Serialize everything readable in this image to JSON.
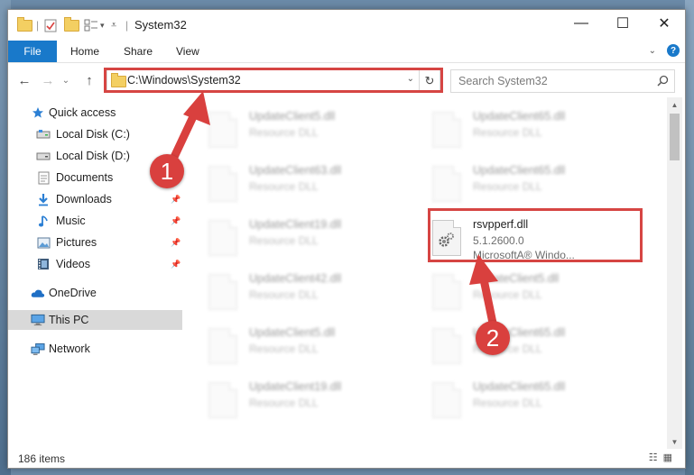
{
  "window": {
    "title": "System32",
    "controls": {
      "minimize": "—",
      "maximize": "☐",
      "close": "✕"
    }
  },
  "ribbon": {
    "tabs": [
      "File",
      "Home",
      "Share",
      "View"
    ],
    "help": "?"
  },
  "nav": {
    "back": "←",
    "forward": "→",
    "recent": "⌄",
    "up": "↑",
    "address": "C:\\Windows\\System32",
    "search_placeholder": "Search System32"
  },
  "sidebar": {
    "items": [
      {
        "label": "Quick access",
        "icon": "star-icon",
        "pinned": false
      },
      {
        "label": "Local Disk (C:)",
        "icon": "drive-icon",
        "pinned": false
      },
      {
        "label": "Local Disk (D:)",
        "icon": "drive-icon",
        "pinned": false
      },
      {
        "label": "Documents",
        "icon": "documents-icon",
        "pinned": true
      },
      {
        "label": "Downloads",
        "icon": "download-icon",
        "pinned": true
      },
      {
        "label": "Music",
        "icon": "music-icon",
        "pinned": true
      },
      {
        "label": "Pictures",
        "icon": "pictures-icon",
        "pinned": true
      },
      {
        "label": "Videos",
        "icon": "videos-icon",
        "pinned": true
      },
      {
        "label": "OneDrive",
        "icon": "cloud-icon",
        "pinned": false
      },
      {
        "label": "This PC",
        "icon": "computer-icon",
        "pinned": false,
        "selected": true
      },
      {
        "label": "Network",
        "icon": "network-icon",
        "pinned": false
      }
    ]
  },
  "files": {
    "left": [
      {
        "name": "UpdateClient5.dll",
        "type": "Resource DLL"
      },
      {
        "name": "UpdateClient63.dll",
        "type": "Resource DLL"
      },
      {
        "name": "UpdateClient19.dll",
        "type": "Resource DLL"
      },
      {
        "name": "UpdateClient42.dll",
        "type": "Resource DLL"
      },
      {
        "name": "UpdateClient5.dll",
        "type": "Resource DLL"
      },
      {
        "name": "UpdateClient19.dll",
        "type": "Resource DLL"
      }
    ],
    "right": [
      {
        "name": "UpdateClient65.dll",
        "type": "Resource DLL"
      },
      {
        "name": "UpdateClient65.dll",
        "type": "Resource DLL"
      },
      {
        "name": "rsvpperf.dll",
        "version": "5.1.2600.0",
        "company": "MicrosoftA® Windo..."
      },
      {
        "name": "UpdateClient5.dll",
        "type": "Resource DLL"
      },
      {
        "name": "UpdateClient65.dll",
        "type": "Resource DLL"
      },
      {
        "name": "UpdateClient65.dll",
        "type": "Resource DLL"
      }
    ]
  },
  "status": {
    "items": "186 items"
  },
  "annotations": {
    "step1": "1",
    "step2": "2",
    "color": "#d9403e"
  }
}
